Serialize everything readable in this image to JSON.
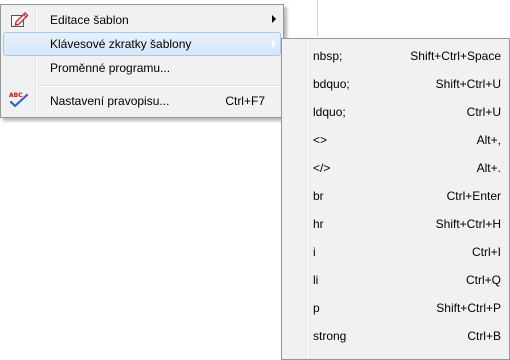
{
  "context_menu": {
    "items": [
      {
        "label": "Editace šablon",
        "icon": "edit-template-icon",
        "submenu": true
      },
      {
        "label": "Klávesové zkratky šablony",
        "submenu": true,
        "highlighted": true
      },
      {
        "label": "Proměnné programu..."
      },
      {
        "label": "Nastavení pravopisu...",
        "shortcut": "Ctrl+F7",
        "icon": "spellcheck-icon",
        "icon_text": "ABC"
      }
    ]
  },
  "shortcuts_submenu": {
    "items": [
      {
        "label": "nbsp;",
        "shortcut": "Shift+Ctrl+Space"
      },
      {
        "label": "bdquo;",
        "shortcut": "Shift+Ctrl+U"
      },
      {
        "label": "ldquo;",
        "shortcut": "Ctrl+U"
      },
      {
        "label": "<>",
        "shortcut": "Alt+,"
      },
      {
        "label": "</>",
        "shortcut": "Alt+."
      },
      {
        "label": "br",
        "shortcut": "Ctrl+Enter"
      },
      {
        "label": "hr",
        "shortcut": "Shift+Ctrl+H"
      },
      {
        "label": "i",
        "shortcut": "Ctrl+I"
      },
      {
        "label": "li",
        "shortcut": "Ctrl+Q"
      },
      {
        "label": "p",
        "shortcut": "Shift+Ctrl+P"
      },
      {
        "label": "strong",
        "shortcut": "Ctrl+B"
      }
    ]
  },
  "colors": {
    "menu_bg": "#f1f1f1",
    "menu_border": "#979797",
    "highlight_bg": "#dceafb",
    "highlight_border": "#a8c8ec",
    "spell_check_mark": "#2a66c8",
    "spell_abc": "#d01010",
    "edit_icon_red": "#d42a2a"
  }
}
